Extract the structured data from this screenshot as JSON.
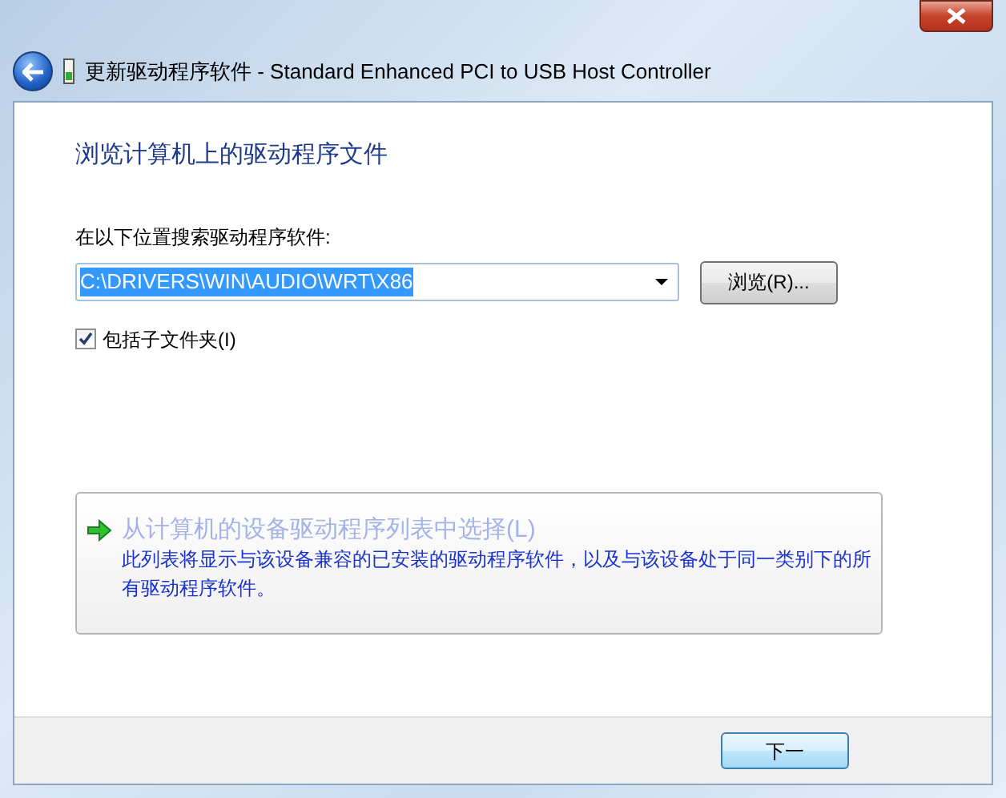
{
  "window": {
    "title": "更新驱动程序软件 - Standard Enhanced PCI to USB Host Controller"
  },
  "heading": "浏览计算机上的驱动程序文件",
  "search_label": "在以下位置搜索驱动程序软件:",
  "path_field": {
    "value": "C:\\DRIVERS\\WIN\\AUDIO\\WRT\\X86"
  },
  "browse_button": "浏览(R)...",
  "include_subfolders": {
    "label": "包括子文件夹(I)",
    "checked": true
  },
  "command_link": {
    "title": "从计算机的设备驱动程序列表中选择(L)",
    "description": "此列表将显示与该设备兼容的已安装的驱动程序软件，以及与该设备处于同一类别下的所有驱动程序软件。"
  },
  "buttons": [
    "下一"
  ]
}
